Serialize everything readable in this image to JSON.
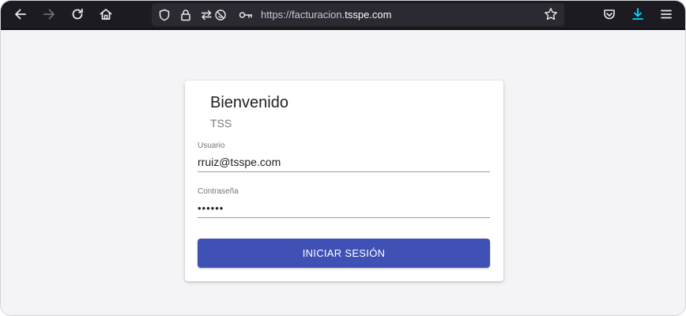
{
  "browser": {
    "url_prefix": "https://facturacion.",
    "url_domain": "tsspe.com",
    "icons": {
      "back": "arrow-left-icon",
      "forward": "arrow-right-icon",
      "reload": "reload-icon",
      "home": "home-icon",
      "tracking": "shield-icon",
      "lock": "lock-icon",
      "permissions": "permissions-icon",
      "key": "key-icon",
      "bookmark": "star-icon",
      "pocket": "pocket-icon",
      "download": "download-icon",
      "menu": "hamburger-menu-icon"
    }
  },
  "login": {
    "title": "Bienvenido",
    "subtitle": "TSS",
    "username_label": "Usuario",
    "username_value": "rruiz@tsspe.com",
    "password_label": "Contraseña",
    "password_value": "rruizp",
    "submit_label": "INICIAR SESIÓN"
  },
  "colors": {
    "toolbar_bg": "#1c1b22",
    "urlbar_bg": "#2b2a33",
    "page_bg": "#f4f4f6",
    "primary_button": "#3f51b5",
    "download_accent": "#00ddff"
  }
}
